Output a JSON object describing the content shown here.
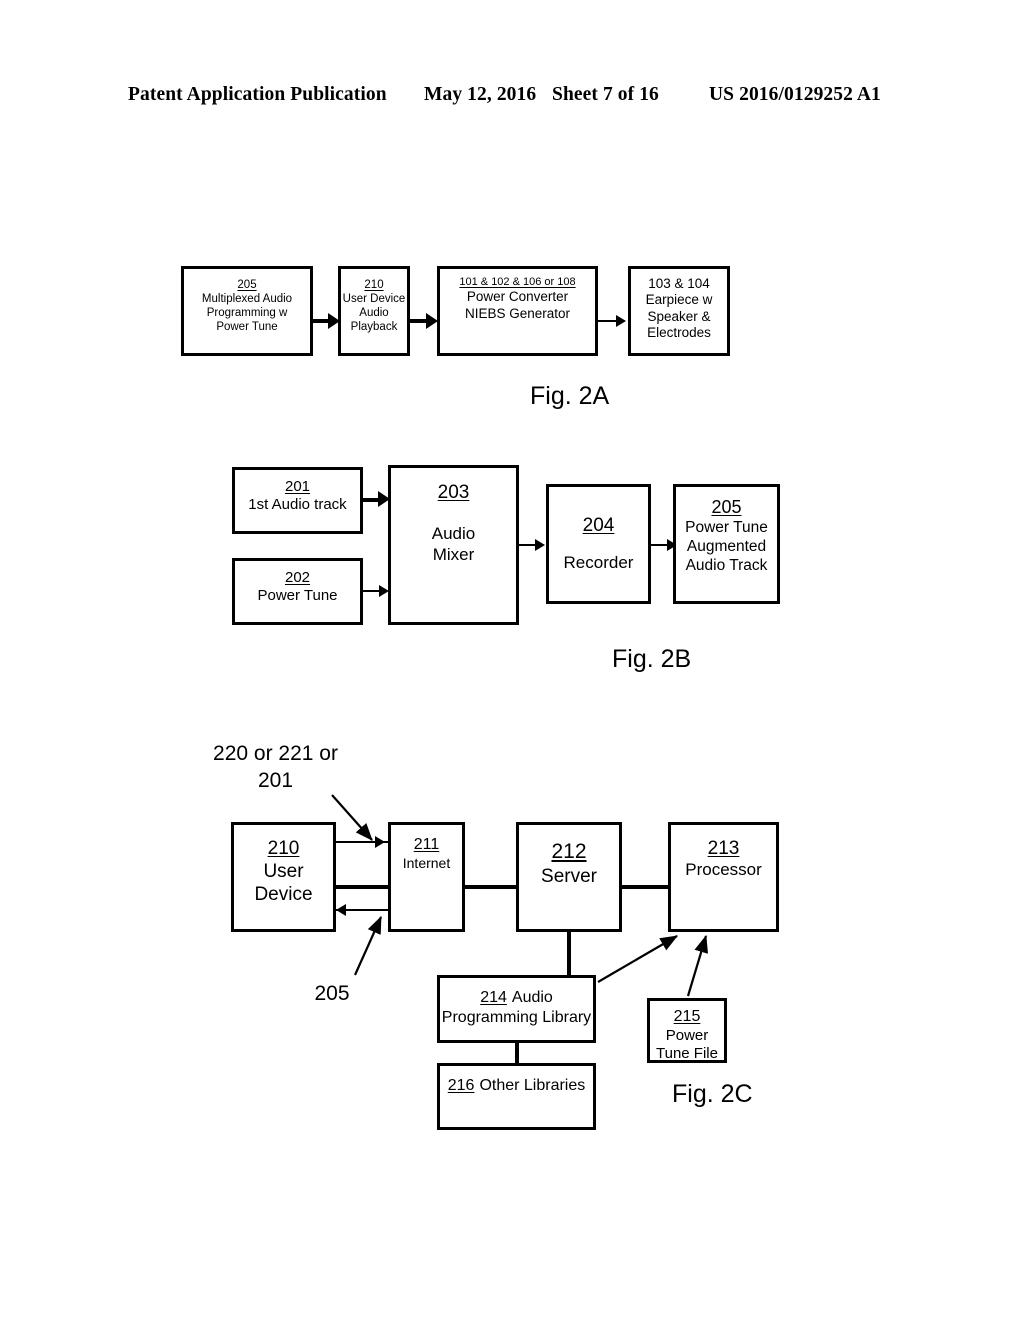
{
  "header": {
    "publication": "Patent Application Publication",
    "date": "May 12, 2016",
    "sheet": "Sheet 7 of 16",
    "patent_number": "US 2016/0129252 A1"
  },
  "figures": [
    {
      "id": "fig-2a",
      "caption": "Fig. 2A",
      "boxes": [
        {
          "ref": "205",
          "ref_underlined": true,
          "lines": [
            "Multiplexed Audio",
            "Programming w",
            "Power Tune"
          ]
        },
        {
          "ref": "210",
          "ref_underlined": true,
          "lines": [
            "User Device",
            "Audio",
            "Playback"
          ]
        },
        {
          "ref": "101 & 102 & 106 or 108",
          "ref_underlined": true,
          "lines": [
            "Power Converter",
            "NIEBS Generator"
          ]
        },
        {
          "ref": "103 & 104",
          "ref_underlined": false,
          "lines": [
            "Earpiece w",
            "Speaker &",
            "Electrodes"
          ]
        }
      ]
    },
    {
      "id": "fig-2b",
      "caption": "Fig. 2B",
      "boxes": [
        {
          "ref": "201",
          "ref_underlined": true,
          "lines": [
            "1st Audio track"
          ]
        },
        {
          "ref": "202",
          "ref_underlined": true,
          "lines": [
            "Power Tune"
          ]
        },
        {
          "ref": "203",
          "ref_underlined": true,
          "lines": [
            "Audio",
            "Mixer"
          ]
        },
        {
          "ref": "204",
          "ref_underlined": true,
          "lines": [
            "Recorder"
          ]
        },
        {
          "ref": "205",
          "ref_underlined": true,
          "lines": [
            "Power Tune",
            "Augmented",
            "Audio Track"
          ]
        }
      ]
    },
    {
      "id": "fig-2c",
      "caption": "Fig. 2C",
      "callouts": [
        {
          "id": "callout-220",
          "lines": [
            "220 or 221 or",
            "201"
          ]
        },
        {
          "id": "callout-205",
          "lines": [
            "205"
          ]
        }
      ],
      "boxes": [
        {
          "ref": "210",
          "ref_underlined": true,
          "lines": [
            "User",
            "Device"
          ]
        },
        {
          "ref": "211",
          "ref_underlined": true,
          "lines": [
            "Internet"
          ]
        },
        {
          "ref": "212",
          "ref_underlined": true,
          "lines": [
            "Server"
          ]
        },
        {
          "ref": "213",
          "ref_underlined": true,
          "lines": [
            "Processor"
          ]
        },
        {
          "ref": "214",
          "ref_underlined": true,
          "inline_ref": true,
          "lines": [
            "Audio",
            "Programming Library"
          ]
        },
        {
          "ref": "215",
          "ref_underlined": true,
          "lines": [
            "Power",
            "Tune File"
          ]
        },
        {
          "ref": "216",
          "ref_underlined": true,
          "inline_ref": true,
          "lines": [
            "Other Libraries"
          ]
        }
      ]
    }
  ]
}
